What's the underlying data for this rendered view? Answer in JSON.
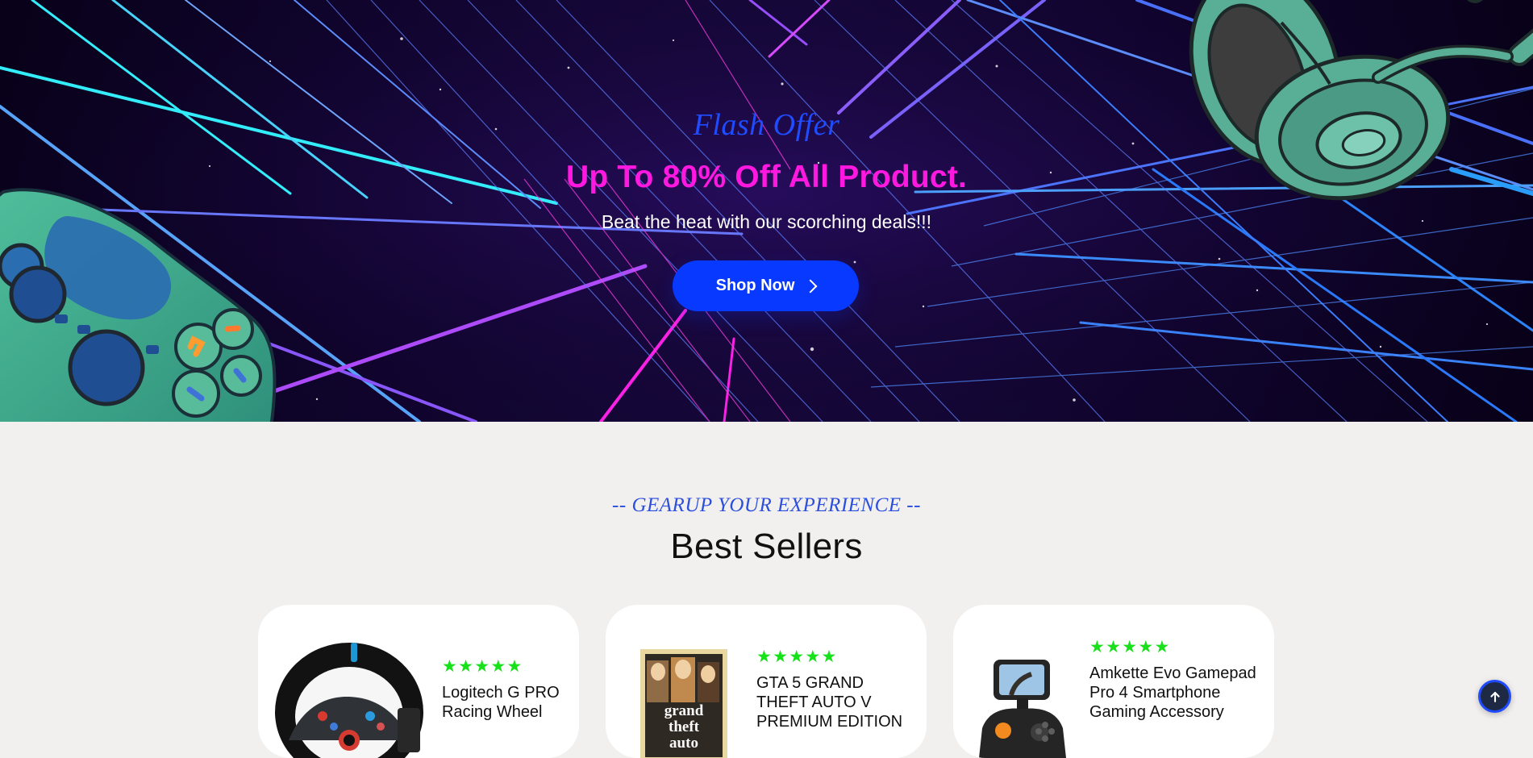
{
  "hero": {
    "flash_label": "Flash Offer",
    "headline": "Up To 80% Off All Product.",
    "subtitle": "Beat the heat with our scorching deals!!!",
    "cta_label": "Shop Now",
    "icons": [
      "chevron-right-icon",
      "gamepad-icon",
      "headphones-icon"
    ]
  },
  "section": {
    "eyebrow": "-- GEARUP YOUR EXPERIENCE --",
    "title": "Best Sellers"
  },
  "products": [
    {
      "rating": "★★★★★",
      "title": "Logitech G PRO Racing Wheel",
      "icon": "racing-wheel-icon"
    },
    {
      "rating": "★★★★★",
      "title": "GTA 5 GRAND THEFT AUTO V PREMIUM EDITION",
      "icon": "game-cover-icon"
    },
    {
      "rating": "★★★★★",
      "title": "Amkette Evo Gamepad Pro 4 Smartphone Gaming Accessory",
      "icon": "phone-gamepad-icon"
    }
  ],
  "controls": {
    "scroll_top_icon": "arrow-up-icon"
  },
  "colors": {
    "accent_blue": "#0839ff",
    "accent_pink": "#ff18df",
    "star_green": "#18e11c",
    "hero_bg": "#10042d",
    "page_bg": "#f2f0ef"
  }
}
